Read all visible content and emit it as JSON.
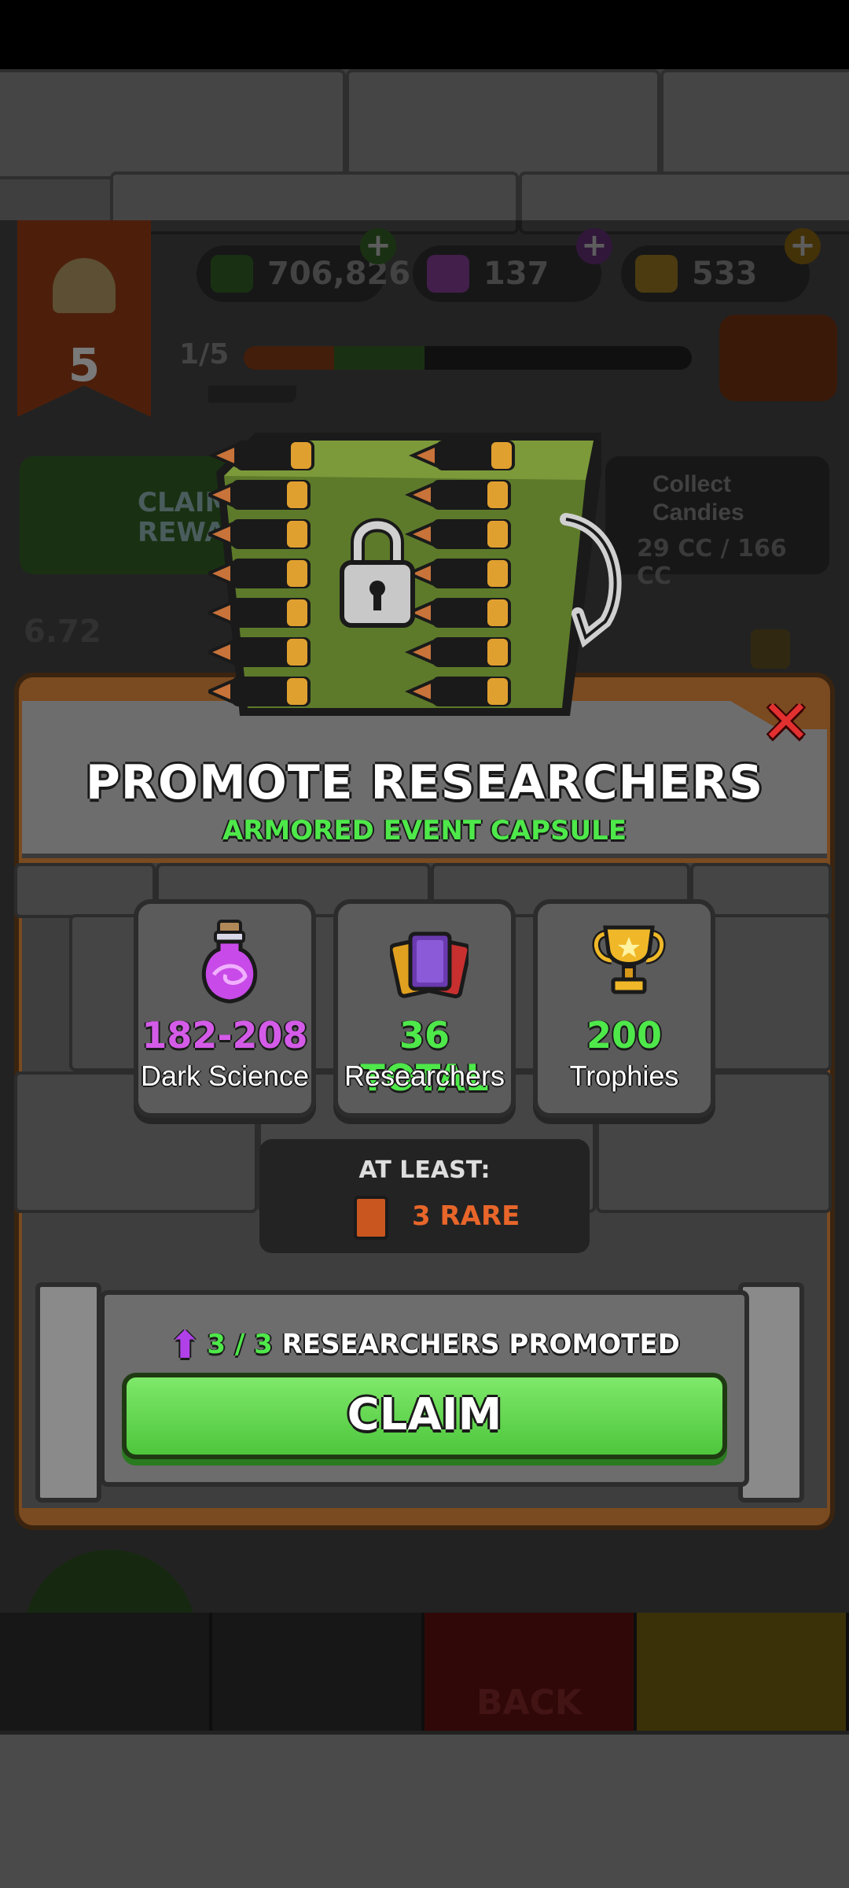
{
  "hud": {
    "level": "5",
    "resources": [
      {
        "name": "cash",
        "value": "706,826",
        "icon": "cash-icon",
        "color": "#2f5a22"
      },
      {
        "name": "dark-science",
        "value": "137",
        "icon": "potion-icon",
        "color": "#7a3a8a"
      },
      {
        "name": "gold",
        "value": "533",
        "icon": "gold-bar-icon",
        "color": "#8a6a20"
      }
    ],
    "progress_label": "1/5",
    "progress": 0.4,
    "claim_reward_label": "CLAIM REWARD",
    "collect_title": "Collect Candies",
    "collect_status": "29 CC / 166 CC",
    "coins_partial": "6.72"
  },
  "modal": {
    "title": "PROMOTE RESEARCHERS",
    "subtitle": "ARMORED EVENT CAPSULE",
    "close_icon": "close-icon",
    "rewards": [
      {
        "value": "182-208",
        "label": "Dark Science",
        "color": "#d45be8",
        "icon": "potion-icon"
      },
      {
        "value": "36 TOTAL",
        "label": "Researchers",
        "color": "#4ee84a",
        "icon": "cards-icon"
      },
      {
        "value": "200",
        "label": "Trophies",
        "color": "#4ee84a",
        "icon": "trophy-icon"
      }
    ],
    "at_least_label": "AT LEAST:",
    "rare_label": "3 RARE",
    "promoted_count": "3 / 3",
    "promoted_text": "RESEARCHERS PROMOTED",
    "claim_label": "CLAIM"
  },
  "tabbar": {
    "back_label": "BACK"
  }
}
